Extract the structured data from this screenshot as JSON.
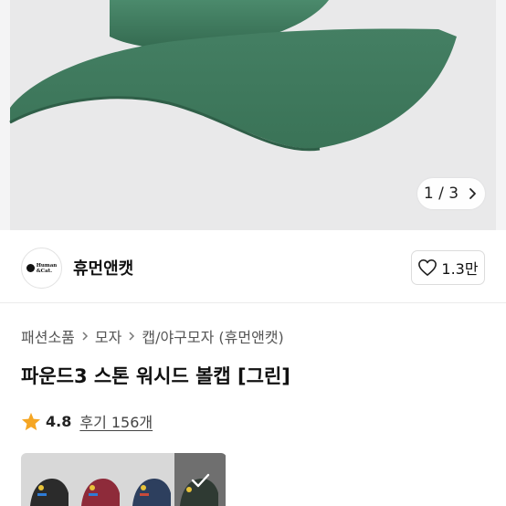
{
  "gallery": {
    "pager_current": "1",
    "pager_separator": "/",
    "pager_total": "3",
    "cap_color": "#3f7a5f"
  },
  "shop": {
    "logo_text_line1": "Human",
    "logo_text_line2": "&Cat.",
    "name": "휴먼앤캣",
    "like_count": "1.3만"
  },
  "breadcrumb": {
    "items": [
      "패션소품",
      "모자",
      "캡/야구모자 (휴먼앤캣)"
    ]
  },
  "product": {
    "title": "파운드3 스톤 워시드 볼캡 [그린]",
    "rating": "4.8",
    "reviews_label": "후기 156개",
    "star_color": "#f5a623"
  },
  "color_options": [
    {
      "name": "black",
      "color": "#2b2b2b"
    },
    {
      "name": "burgundy",
      "color": "#8e2b3a"
    },
    {
      "name": "navy",
      "color": "#2d3f5e"
    },
    {
      "name": "green",
      "color": "#2f3a33",
      "selected": true
    }
  ]
}
